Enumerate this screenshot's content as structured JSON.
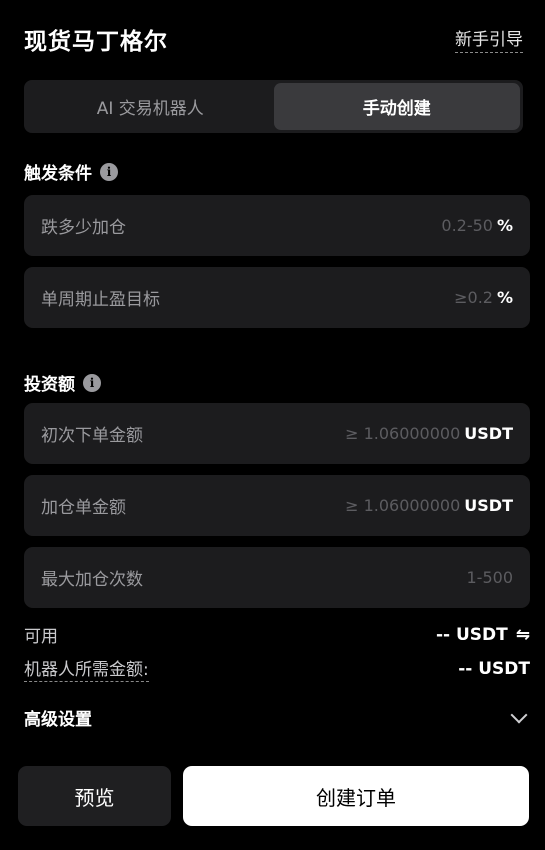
{
  "header": {
    "title": "现货马丁格尔",
    "guide_link": "新手引导"
  },
  "tabs": [
    {
      "label": "AI 交易机器人",
      "active": false
    },
    {
      "label": "手动创建",
      "active": true
    }
  ],
  "trigger": {
    "title": "触发条件",
    "fields": [
      {
        "label": "跌多少加仓",
        "hint": "0.2-50",
        "unit": "%"
      },
      {
        "label": "单周期止盈目标",
        "hint": "≥0.2",
        "unit": "%"
      }
    ]
  },
  "investment": {
    "title": "投资额",
    "fields": [
      {
        "label": "初次下单金额",
        "hint": "≥ 1.06000000",
        "unit": "USDT"
      },
      {
        "label": "加仓单金额",
        "hint": "≥ 1.06000000",
        "unit": "USDT"
      },
      {
        "label": "最大加仓次数",
        "hint": "1-500",
        "unit": ""
      }
    ]
  },
  "available": {
    "label": "可用",
    "value": "-- USDT",
    "icon": "swap-icon"
  },
  "required": {
    "label": "机器人所需金额:",
    "value": "-- USDT"
  },
  "advanced": {
    "label": "高级设置",
    "icon": "chevron-down-icon"
  },
  "buttons": {
    "preview": "预览",
    "create": "创建订单"
  },
  "colors": {
    "background": "#000000",
    "card": "#1c1c1e",
    "primary_button": "#ffffff"
  }
}
